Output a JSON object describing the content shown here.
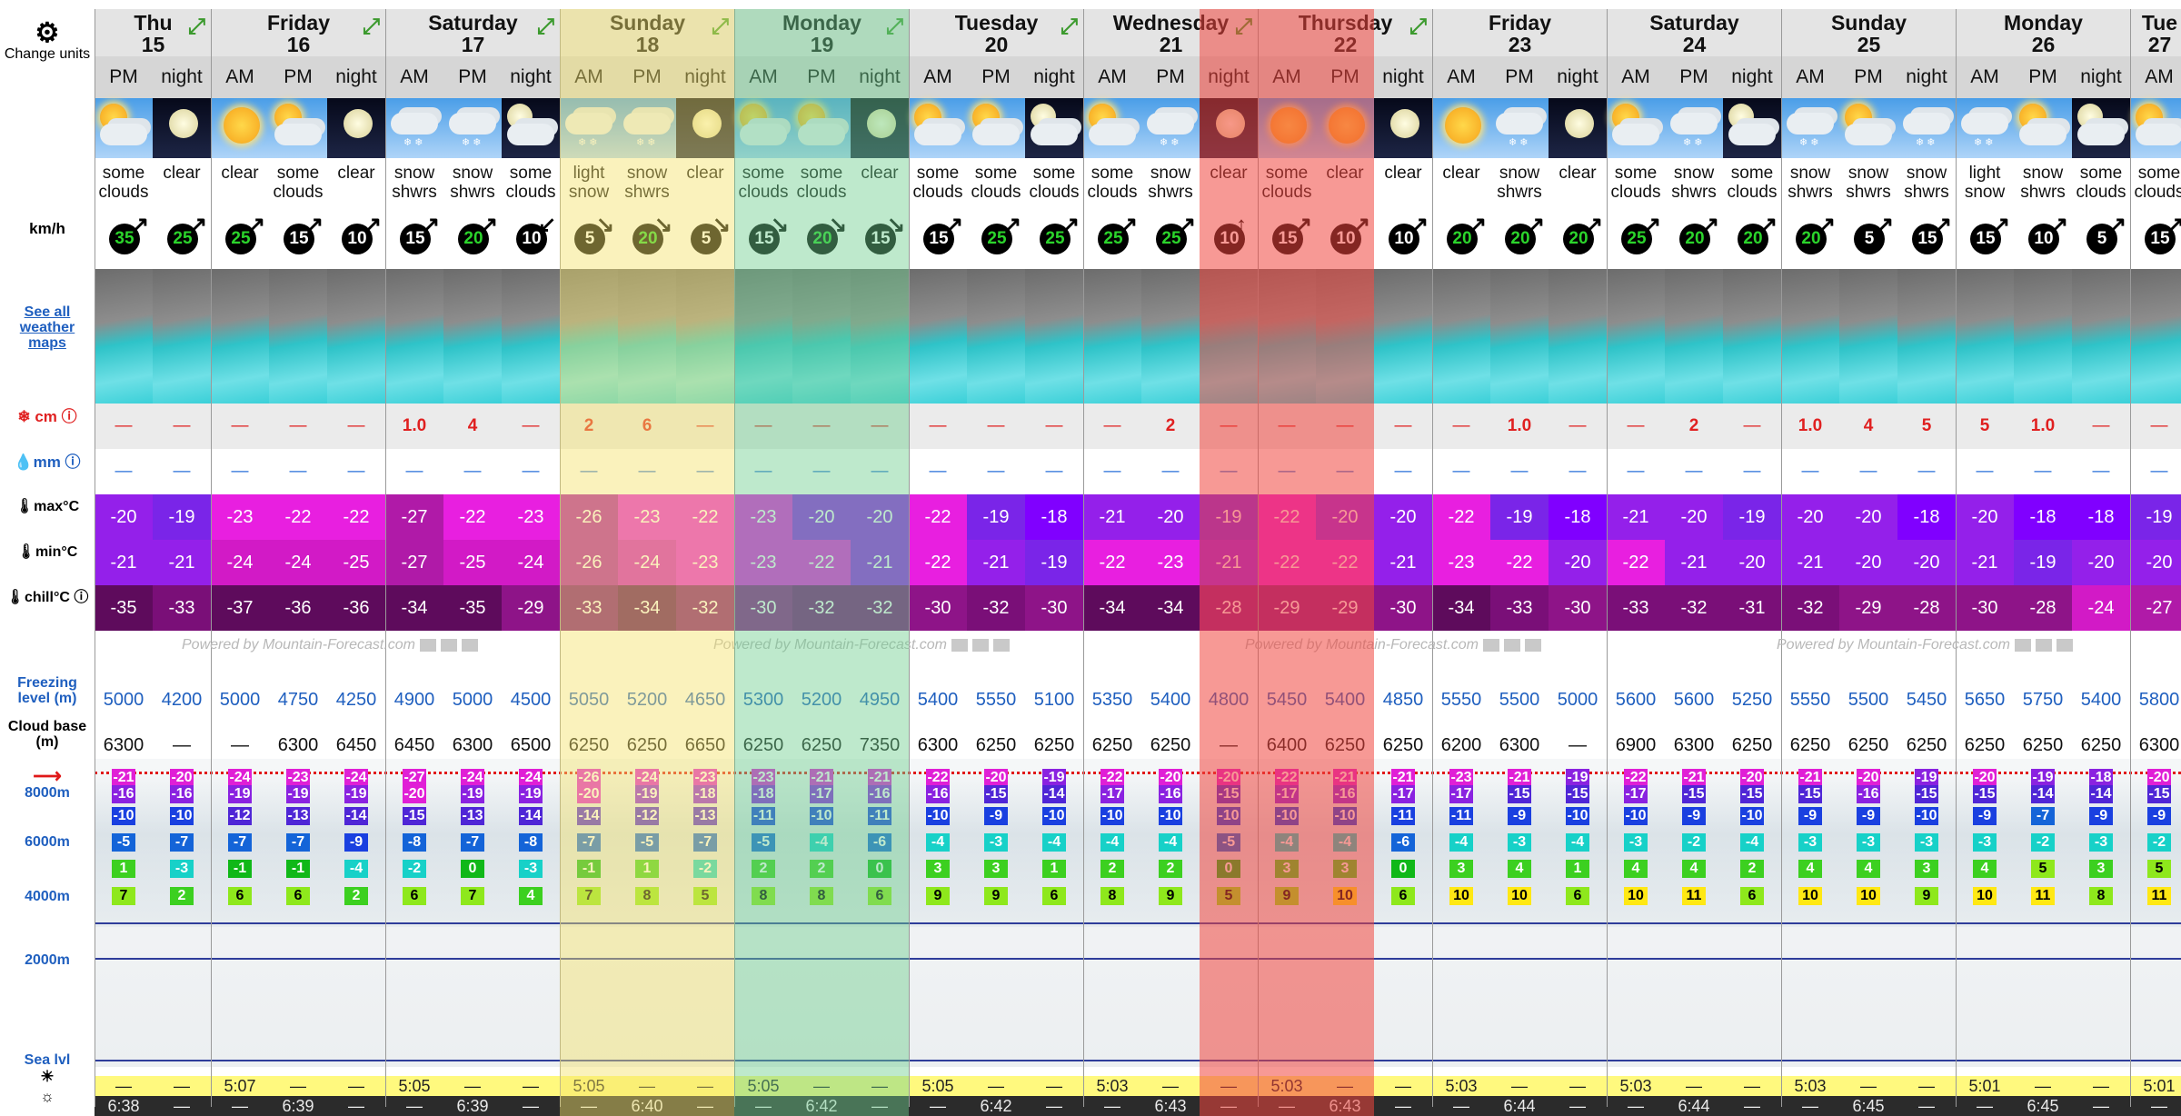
{
  "left": {
    "change_units": "Change units",
    "speed_unit": "km/h",
    "see_all_maps": "See all weather maps",
    "snow_label": "cm",
    "rain_label": "mm",
    "max_label": "max°C",
    "min_label": "min°C",
    "chill_label": "chill°C",
    "freezing_label": "Freezing level (m)",
    "cloud_label": "Cloud base (m)",
    "alt_8000": "8000m",
    "alt_6000": "6000m",
    "alt_4000": "4000m",
    "alt_2000": "2000m",
    "sea_level": "Sea lvl"
  },
  "days": [
    {
      "name": "Thu",
      "date": "15",
      "cols": 2,
      "expand_icon": "expand-arrows-icon"
    },
    {
      "name": "Friday",
      "date": "16",
      "cols": 3,
      "expand_icon": "expand-arrows-icon"
    },
    {
      "name": "Saturday",
      "date": "17",
      "cols": 3,
      "expand_icon": "expand-arrows-icon"
    },
    {
      "name": "Sunday",
      "date": "18",
      "cols": 3,
      "expand_icon": "expand-arrows-icon"
    },
    {
      "name": "Monday",
      "date": "19",
      "cols": 3,
      "expand_icon": "expand-arrows-icon"
    },
    {
      "name": "Tuesday",
      "date": "20",
      "cols": 3,
      "expand_icon": "expand-arrows-icon"
    },
    {
      "name": "Wednesday",
      "date": "21",
      "cols": 3,
      "expand_icon": "expand-arrows-icon"
    },
    {
      "name": "Thursday",
      "date": "22",
      "cols": 3,
      "expand_icon": "expand-arrows-icon"
    },
    {
      "name": "Friday",
      "date": "23",
      "cols": 3,
      "expand_icon": ""
    },
    {
      "name": "Saturday",
      "date": "24",
      "cols": 3,
      "expand_icon": ""
    },
    {
      "name": "Sunday",
      "date": "25",
      "cols": 3,
      "expand_icon": ""
    },
    {
      "name": "Monday",
      "date": "26",
      "cols": 3,
      "expand_icon": ""
    },
    {
      "name": "Tue",
      "date": "27",
      "cols": 1,
      "expand_icon": ""
    }
  ],
  "periods": [
    "PM",
    "night",
    "AM",
    "PM",
    "night",
    "AM",
    "PM",
    "night",
    "AM",
    "PM",
    "night",
    "AM",
    "PM",
    "night",
    "AM",
    "PM",
    "night",
    "AM",
    "PM",
    "night",
    "AM",
    "PM",
    "night",
    "AM",
    "PM",
    "night",
    "AM",
    "PM",
    "night",
    "AM",
    "PM",
    "night",
    "AM",
    "PM",
    "night",
    "AM"
  ],
  "icons": [
    "cloud-sun",
    "moon",
    "sun",
    "cloud-sun",
    "moon",
    "snow-cloud",
    "snow-cloud",
    "cloud-moon",
    "snow-cloud",
    "snow-cloud",
    "moon",
    "cloud-sun",
    "cloud-sun",
    "moon",
    "cloud-sun",
    "cloud-sun",
    "cloud-moon",
    "cloud-sun",
    "snow-cloud",
    "moon",
    "sun",
    "sun",
    "moon",
    "sun",
    "snow-cloud",
    "moon",
    "cloud-sun",
    "snow-cloud",
    "cloud-moon",
    "snow-cloud",
    "cloud-sun",
    "snow-cloud",
    "snow-cloud",
    "cloud-sun",
    "cloud-moon",
    "cloud-sun"
  ],
  "descriptions": [
    "some clouds",
    "clear",
    "clear",
    "some clouds",
    "clear",
    "snow shwrs",
    "snow shwrs",
    "some clouds",
    "light snow",
    "snow shwrs",
    "clear",
    "some clouds",
    "some clouds",
    "clear",
    "some clouds",
    "some clouds",
    "some clouds",
    "some clouds",
    "snow shwrs",
    "clear",
    "some clouds",
    "clear",
    "clear",
    "clear",
    "snow shwrs",
    "clear",
    "some clouds",
    "snow shwrs",
    "some clouds",
    "snow shwrs",
    "snow shwrs",
    "snow shwrs",
    "light snow",
    "snow shwrs",
    "some clouds",
    "some clouds"
  ],
  "wind": [
    "35",
    "25",
    "25",
    "15",
    "10",
    "15",
    "20",
    "10",
    "5",
    "20",
    "5",
    "15",
    "20",
    "15",
    "15",
    "25",
    "25",
    "25",
    "25",
    "10",
    "15",
    "10",
    "10",
    "20",
    "20",
    "20",
    "25",
    "20",
    "20",
    "20",
    "5",
    "15",
    "15",
    "10",
    "5",
    "15"
  ],
  "wind_arrows": [
    "↗",
    "↗",
    "↗",
    "↗",
    "↗",
    "↗",
    "↗",
    "↙",
    "↘",
    "↘",
    "↘",
    "↘",
    "↘",
    "↘",
    "↗",
    "↗",
    "↗",
    "↗",
    "↗",
    "↑",
    "↗",
    "↗",
    "↗",
    "↗",
    "↗",
    "↗",
    "↗",
    "↗",
    "↗",
    "↗",
    "↗",
    "↗",
    "↗",
    "↗",
    "↗",
    "↗"
  ],
  "snow": [
    "—",
    "—",
    "—",
    "—",
    "—",
    "1.0",
    "4",
    "—",
    "2",
    "6",
    "—",
    "—",
    "—",
    "—",
    "—",
    "—",
    "—",
    "—",
    "2",
    "—",
    "—",
    "—",
    "—",
    "—",
    "1.0",
    "—",
    "—",
    "2",
    "—",
    "1.0",
    "4",
    "5",
    "5",
    "1.0",
    "—",
    "—"
  ],
  "rain": [
    "—",
    "—",
    "—",
    "—",
    "—",
    "—",
    "—",
    "—",
    "—",
    "—",
    "—",
    "—",
    "—",
    "—",
    "—",
    "—",
    "—",
    "—",
    "—",
    "—",
    "—",
    "—",
    "—",
    "—",
    "—",
    "—",
    "—",
    "—",
    "—",
    "—",
    "—",
    "—",
    "—",
    "—",
    "—",
    "—"
  ],
  "tmax": [
    "-20",
    "-19",
    "-23",
    "-22",
    "-22",
    "-27",
    "-22",
    "-23",
    "-26",
    "-23",
    "-22",
    "-23",
    "-20",
    "-20",
    "-22",
    "-19",
    "-18",
    "-21",
    "-20",
    "-19",
    "-22",
    "-20",
    "-20",
    "-22",
    "-19",
    "-18",
    "-21",
    "-20",
    "-19",
    "-20",
    "-20",
    "-18",
    "-20",
    "-18",
    "-18",
    "-19"
  ],
  "tmin": [
    "-21",
    "-21",
    "-24",
    "-24",
    "-25",
    "-27",
    "-25",
    "-24",
    "-26",
    "-24",
    "-23",
    "-23",
    "-22",
    "-21",
    "-22",
    "-21",
    "-19",
    "-22",
    "-23",
    "-21",
    "-22",
    "-22",
    "-21",
    "-23",
    "-22",
    "-20",
    "-22",
    "-21",
    "-20",
    "-21",
    "-20",
    "-20",
    "-21",
    "-19",
    "-20",
    "-20"
  ],
  "tchill": [
    "-35",
    "-33",
    "-37",
    "-36",
    "-36",
    "-34",
    "-35",
    "-29",
    "-33",
    "-34",
    "-32",
    "-30",
    "-32",
    "-32",
    "-30",
    "-32",
    "-30",
    "-34",
    "-34",
    "-28",
    "-29",
    "-29",
    "-30",
    "-34",
    "-33",
    "-30",
    "-33",
    "-32",
    "-31",
    "-32",
    "-29",
    "-28",
    "-30",
    "-28",
    "-24",
    "-27"
  ],
  "freezing": [
    "5000",
    "4200",
    "5000",
    "4750",
    "4250",
    "4900",
    "5000",
    "4500",
    "5050",
    "5200",
    "4650",
    "5300",
    "5200",
    "4950",
    "5400",
    "5550",
    "5100",
    "5350",
    "5400",
    "4800",
    "5450",
    "5400",
    "4850",
    "5550",
    "5500",
    "5000",
    "5600",
    "5600",
    "5250",
    "5550",
    "5500",
    "5450",
    "5650",
    "5750",
    "5400",
    "5800"
  ],
  "cloud_base": [
    "6300",
    "—",
    "—",
    "6300",
    "6450",
    "6450",
    "6300",
    "6500",
    "6250",
    "6250",
    "6650",
    "6250",
    "6250",
    "7350",
    "6300",
    "6250",
    "6250",
    "6250",
    "6250",
    "—",
    "6400",
    "6250",
    "6250",
    "6200",
    "6300",
    "—",
    "6900",
    "6300",
    "6250",
    "6250",
    "6250",
    "6250",
    "6250",
    "6250",
    "6250",
    "6300"
  ],
  "powered_text": "Powered by Mountain-Forecast.com",
  "alt_rows": {
    "r1": [
      "-21",
      "-20",
      "-24",
      "-23",
      "-24",
      "-27",
      "-24",
      "-24",
      "-26",
      "-24",
      "-23",
      "-23",
      "-21",
      "-21",
      "-22",
      "-20",
      "-19",
      "-22",
      "-20",
      "-20",
      "-22",
      "-21",
      "-21",
      "-23",
      "-21",
      "-19",
      "-22",
      "-21",
      "-20",
      "-21",
      "-20",
      "-19",
      "-20",
      "-19",
      "-18",
      "-20"
    ],
    "r2": [
      "-16",
      "-16",
      "-19",
      "-19",
      "-19",
      "-20",
      "-19",
      "-19",
      "-20",
      "-19",
      "-18",
      "-18",
      "-17",
      "-16",
      "-16",
      "-15",
      "-14",
      "-17",
      "-16",
      "-15",
      "-17",
      "-16",
      "-17",
      "-17",
      "-15",
      "-15",
      "-17",
      "-15",
      "-15",
      "-15",
      "-16",
      "-15",
      "-15",
      "-14",
      "-14",
      "-15"
    ],
    "r3": [
      "-10",
      "-10",
      "-12",
      "-13",
      "-14",
      "-15",
      "-13",
      "-14",
      "-14",
      "-12",
      "-13",
      "-11",
      "-10",
      "-11",
      "-10",
      "-9",
      "-10",
      "-10",
      "-10",
      "-10",
      "-10",
      "-10",
      "-11",
      "-11",
      "-9",
      "-10",
      "-10",
      "-9",
      "-10",
      "-9",
      "-9",
      "-10",
      "-9",
      "-7",
      "-9",
      "-9"
    ],
    "r4": [
      "-5",
      "-7",
      "-7",
      "-7",
      "-9",
      "-8",
      "-7",
      "-8",
      "-7",
      "-5",
      "-7",
      "-5",
      "-4",
      "-6",
      "-4",
      "-3",
      "-4",
      "-4",
      "-4",
      "-5",
      "-4",
      "-4",
      "-6",
      "-4",
      "-3",
      "-4",
      "-3",
      "-2",
      "-4",
      "-3",
      "-3",
      "-3",
      "-3",
      "-2",
      "-3",
      "-2"
    ],
    "r5": [
      "1",
      "-3",
      "-1",
      "-1",
      "-4",
      "-2",
      "0",
      "-3",
      "-1",
      "1",
      "-2",
      "2",
      "2",
      "0",
      "3",
      "3",
      "1",
      "2",
      "2",
      "0",
      "3",
      "3",
      "0",
      "3",
      "4",
      "1",
      "4",
      "4",
      "2",
      "4",
      "4",
      "3",
      "4",
      "5",
      "3",
      "5"
    ],
    "r6": [
      "7",
      "2",
      "6",
      "6",
      "2",
      "6",
      "7",
      "4",
      "7",
      "8",
      "5",
      "8",
      "8",
      "6",
      "9",
      "9",
      "6",
      "8",
      "9",
      "5",
      "9",
      "10",
      "6",
      "10",
      "10",
      "6",
      "10",
      "11",
      "6",
      "10",
      "10",
      "9",
      "10",
      "11",
      "8",
      "11"
    ]
  },
  "sunrise": [
    "—",
    "—",
    "5:07",
    "—",
    "—",
    "5:05",
    "—",
    "—",
    "5:05",
    "—",
    "—",
    "5:05",
    "—",
    "—",
    "5:05",
    "—",
    "—",
    "5:03",
    "—",
    "—",
    "5:03",
    "—",
    "—",
    "5:03",
    "—",
    "—",
    "5:03",
    "—",
    "—",
    "5:03",
    "—",
    "—",
    "5:01",
    "—",
    "—",
    "5:01"
  ],
  "sunset": [
    "6:38",
    "—",
    "—",
    "6:39",
    "—",
    "—",
    "6:39",
    "—",
    "—",
    "6:40",
    "—",
    "—",
    "6:42",
    "—",
    "—",
    "6:42",
    "—",
    "—",
    "6:43",
    "—",
    "—",
    "6:43",
    "—",
    "—",
    "6:44",
    "—",
    "—",
    "6:44",
    "—",
    "—",
    "6:45",
    "—",
    "—",
    "6:45",
    "—",
    "—"
  ],
  "highlight_colors": {
    "sunday": "#f3e36a",
    "monday": "#6fcf8e",
    "wednesday_thursday": "#f0463e"
  },
  "colors": {
    "blue_text": "#1f5fbf",
    "green_wind": "#2bd42b",
    "snow_red": "#e02020"
  }
}
